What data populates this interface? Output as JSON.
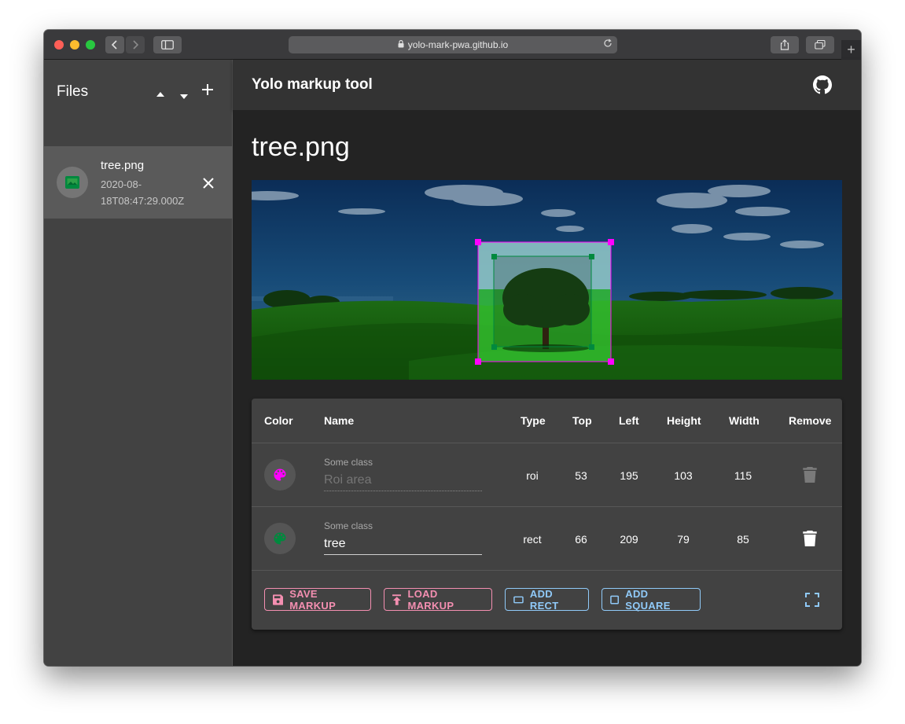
{
  "browser": {
    "url": "yolo-mark-pwa.github.io",
    "new_tab_label": "+"
  },
  "sidebar": {
    "title": "Files",
    "files": [
      {
        "name": "tree.png",
        "date": "2020-08-18T08:47:29.000Z"
      }
    ]
  },
  "appbar": {
    "title": "Yolo markup tool"
  },
  "main": {
    "page_title": "tree.png"
  },
  "table": {
    "headers": {
      "color": "Color",
      "name": "Name",
      "type": "Type",
      "top": "Top",
      "left": "Left",
      "height": "Height",
      "width": "Width",
      "remove": "Remove"
    },
    "rows": [
      {
        "color": "#ff00ff",
        "field_label": "Some class",
        "name": "",
        "placeholder": "Roi area",
        "type": "roi",
        "top": "53",
        "left": "195",
        "height": "103",
        "width": "115"
      },
      {
        "color": "#00893e",
        "field_label": "Some class",
        "name": "tree",
        "placeholder": "",
        "type": "rect",
        "top": "66",
        "left": "209",
        "height": "79",
        "width": "85"
      }
    ]
  },
  "actions": {
    "save": "SAVE MARKUP",
    "load": "LOAD MARKUP",
    "add_rect": "ADD RECT",
    "add_square": "ADD SQUARE"
  },
  "colors": {
    "accent_pink": "#f48fb1",
    "accent_blue": "#90caf9",
    "roi_color": "#ff00ff",
    "rect_color": "#00893e"
  }
}
